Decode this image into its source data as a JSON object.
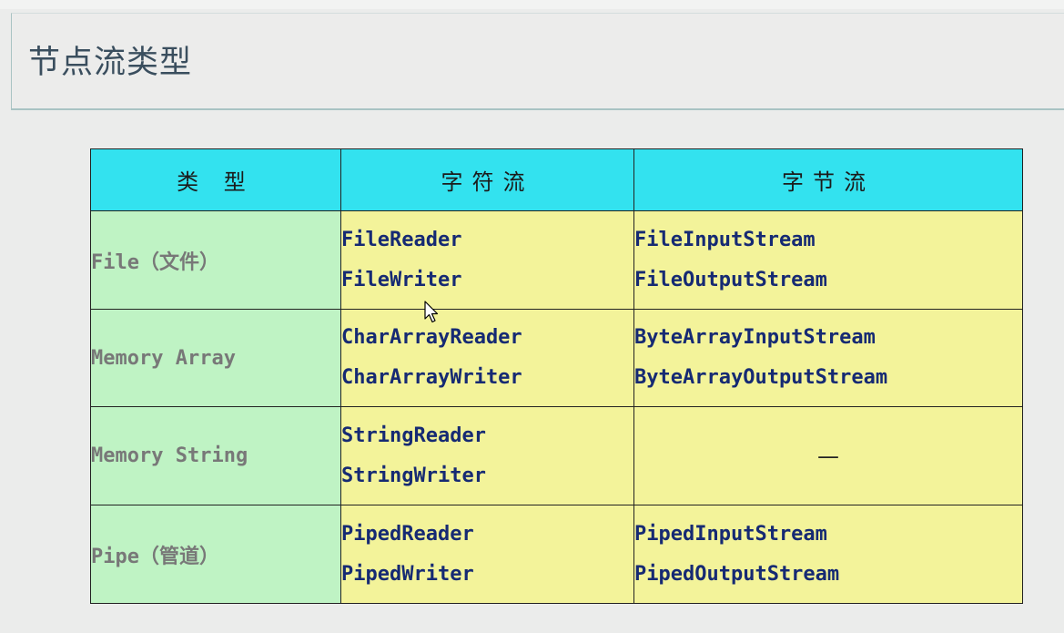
{
  "title": "节点流类型",
  "table": {
    "headers": [
      "类 型",
      "字符流",
      "字节流"
    ],
    "rows": [
      {
        "type": "File（文件）",
        "char": [
          "FileReader",
          "FileWriter"
        ],
        "byte": [
          "FileInputStream",
          "FileOutputStream"
        ]
      },
      {
        "type": "Memory Array",
        "char": [
          "CharArrayReader",
          "CharArrayWriter"
        ],
        "byte": [
          "ByteArrayInputStream",
          "ByteArrayOutputStream"
        ]
      },
      {
        "type": "Memory String",
        "char": [
          "StringReader",
          "StringWriter"
        ],
        "byte": [
          "—"
        ]
      },
      {
        "type": "Pipe（管道）",
        "char": [
          "PipedReader",
          "PipedWriter"
        ],
        "byte": [
          "PipedInputStream",
          "PipedOutputStream"
        ]
      }
    ]
  },
  "colors": {
    "header_bg": "#33e2ef",
    "type_bg": "#bff3c4",
    "class_bg": "#f3f39a",
    "class_text": "#162a73",
    "type_text": "#787878"
  }
}
